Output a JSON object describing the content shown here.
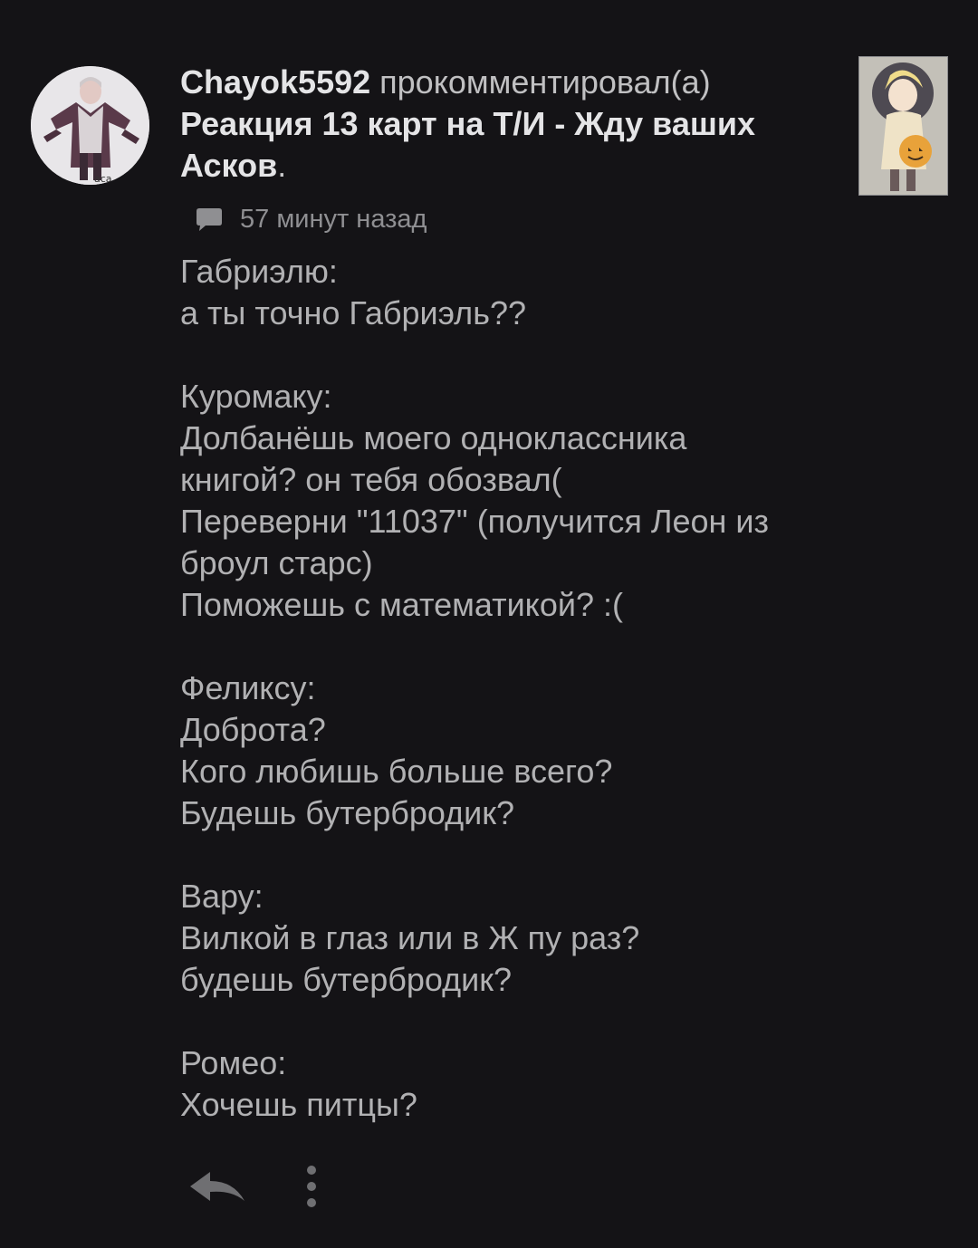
{
  "notification": {
    "username": "Chayok5592",
    "action_text": "прокомментировал(а)",
    "post_title": "Реакция 13 карт на Т/И - Жду ваших Асков",
    "title_suffix": ".",
    "time_ago": "57 минут назад",
    "icons": {
      "comment": "comment-bubble-icon",
      "reply": "reply-arrow-icon",
      "more": "more-vertical-icon"
    },
    "colors": {
      "background": "#141316",
      "text": "#b1b1b3",
      "title": "#e4e4e6",
      "meta": "#8f8f92"
    }
  },
  "comment": {
    "lines": [
      "Габриэлю:",
      "а ты точно Габриэль??",
      "",
      "Куромаку:",
      "Долбанёшь моего одноклассника",
      "книгой? он тебя обозвал(",
      "Переверни \"11037\" (получится Леон из",
      "броул старс)",
      "Поможешь с математикой? :(",
      "",
      "Феликсу:",
      "Доброта?",
      "Кого любишь больше всего?",
      "Будешь бутербродик?",
      "",
      "Вару:",
      "Вилкой в глаз или в Ж пу раз?",
      "будешь бутербродик?",
      "",
      "Ромео:",
      "Хочешь питцы?"
    ]
  }
}
